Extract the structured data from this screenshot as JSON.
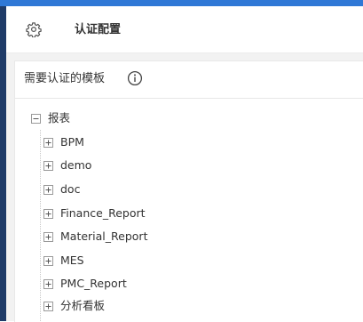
{
  "header": {
    "icon": "gear-icon",
    "title": "认证配置"
  },
  "section": {
    "title": "需要认证的模板",
    "info_icon": "info-icon"
  },
  "tree": {
    "root": {
      "label": "报表",
      "expanded": true
    },
    "children": [
      {
        "label": "BPM",
        "expanded": false
      },
      {
        "label": "demo",
        "expanded": false
      },
      {
        "label": "doc",
        "expanded": false
      },
      {
        "label": "Finance_Report",
        "expanded": false
      },
      {
        "label": "Material_Report",
        "expanded": false
      },
      {
        "label": "MES",
        "expanded": false
      },
      {
        "label": "PMC_Report",
        "expanded": false
      },
      {
        "label": "分析看板",
        "expanded": false
      }
    ]
  },
  "colors": {
    "sidebar": "#1f3b68",
    "topbar": "#2f78d6",
    "content_background": "#f2f2f2"
  }
}
